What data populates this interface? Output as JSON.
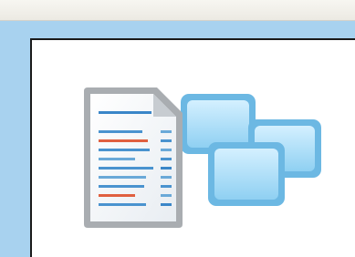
{
  "window": {
    "title": ""
  },
  "illustration": {
    "icon": "report-document-with-windows-icon",
    "document_line_colors": [
      "#3a86c8",
      "#e06040",
      "#4a93cf",
      "#6aa9d8"
    ],
    "window_color": "#8fd0f2"
  },
  "colors": {
    "background": "#a8d2ef",
    "panel": "#ffffff",
    "titlebar": "#f1f0ea",
    "panel_border": "#1a1a1a"
  }
}
